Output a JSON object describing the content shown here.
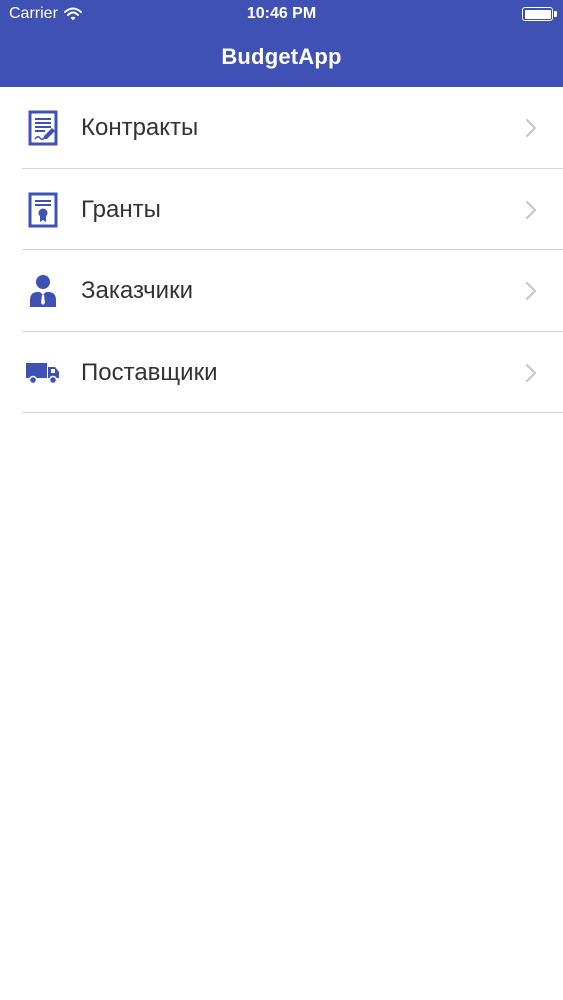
{
  "status_bar": {
    "carrier": "Carrier",
    "time": "10:46 PM",
    "battery_level": 1.0
  },
  "nav_bar": {
    "title": "BudgetApp",
    "background_color": "#3f51b5"
  },
  "menu": {
    "items": [
      {
        "label": "Контракты",
        "icon": "contract-document-icon"
      },
      {
        "label": "Гранты",
        "icon": "grant-certificate-icon"
      },
      {
        "label": "Заказчики",
        "icon": "customer-person-icon"
      },
      {
        "label": "Поставщики",
        "icon": "supplier-truck-icon"
      }
    ],
    "accessory_icon": "chevron-right-icon"
  }
}
